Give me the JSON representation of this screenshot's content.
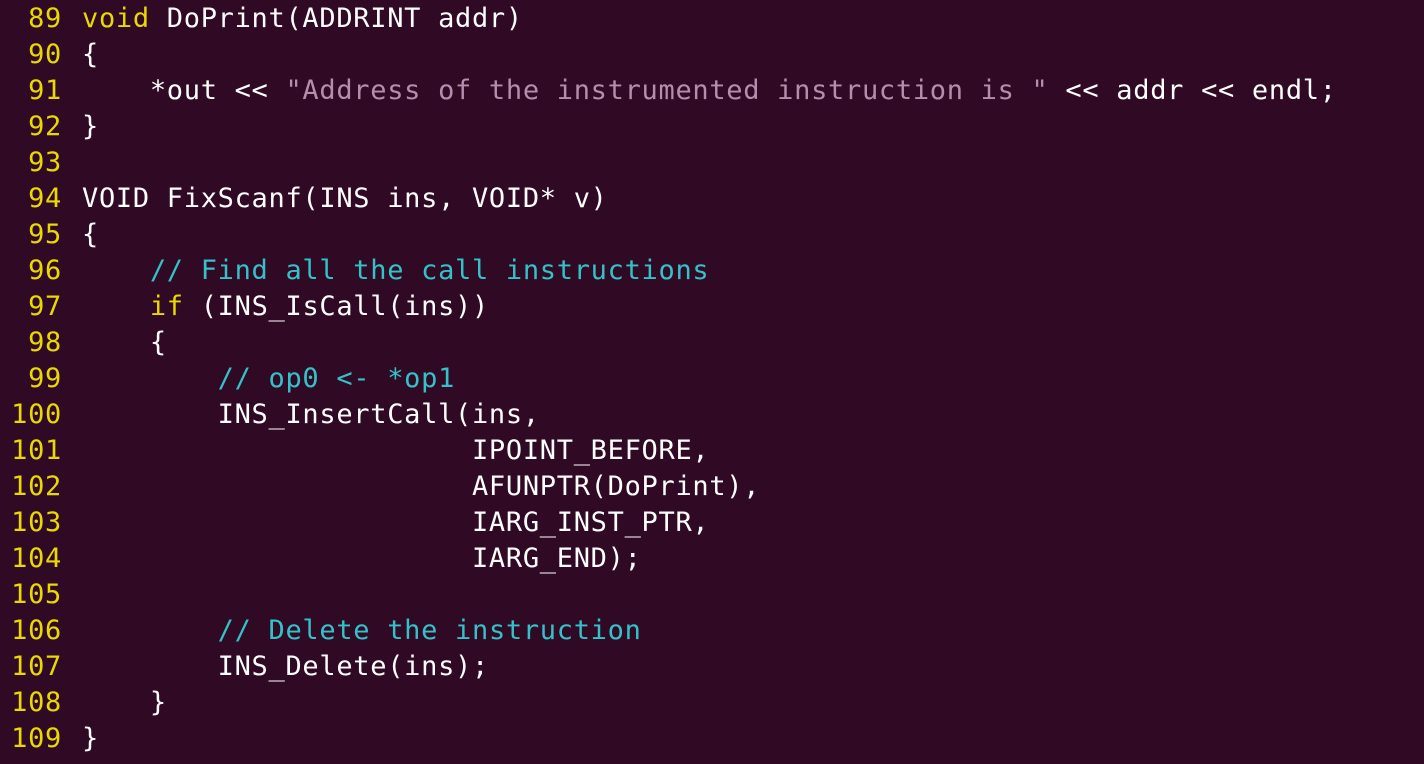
{
  "window_title": "",
  "colors": {
    "background": "#300a24",
    "line_number": "#e8d900",
    "text": "#ffffff",
    "keyword": "#e8d900",
    "string": "#b48ead",
    "comment": "#35c1c9"
  },
  "code": {
    "lines": [
      {
        "number": "89",
        "tokens": [
          {
            "t": "kw",
            "v": "void"
          },
          {
            "t": "text",
            "v": " DoPrint(ADDRINT addr)"
          }
        ]
      },
      {
        "number": "90",
        "tokens": [
          {
            "t": "text",
            "v": "{"
          }
        ]
      },
      {
        "number": "91",
        "tokens": [
          {
            "t": "text",
            "v": "    *out << "
          },
          {
            "t": "str",
            "v": "\"Address of the instrumented instruction is \""
          },
          {
            "t": "text",
            "v": " << addr << endl;"
          }
        ]
      },
      {
        "number": "92",
        "tokens": [
          {
            "t": "text",
            "v": "}"
          }
        ]
      },
      {
        "number": "93",
        "tokens": []
      },
      {
        "number": "94",
        "tokens": [
          {
            "t": "text",
            "v": "VOID FixScanf(INS ins, VOID* v)"
          }
        ]
      },
      {
        "number": "95",
        "tokens": [
          {
            "t": "text",
            "v": "{"
          }
        ]
      },
      {
        "number": "96",
        "tokens": [
          {
            "t": "text",
            "v": "    "
          },
          {
            "t": "comment",
            "v": "// Find all the call instructions"
          }
        ]
      },
      {
        "number": "97",
        "tokens": [
          {
            "t": "text",
            "v": "    "
          },
          {
            "t": "kw",
            "v": "if"
          },
          {
            "t": "text",
            "v": " (INS_IsCall(ins))"
          }
        ]
      },
      {
        "number": "98",
        "tokens": [
          {
            "t": "text",
            "v": "    {"
          }
        ]
      },
      {
        "number": "99",
        "tokens": [
          {
            "t": "text",
            "v": "        "
          },
          {
            "t": "comment",
            "v": "// op0 <- *op1"
          }
        ]
      },
      {
        "number": "100",
        "tokens": [
          {
            "t": "text",
            "v": "        INS_InsertCall(ins,"
          }
        ]
      },
      {
        "number": "101",
        "tokens": [
          {
            "t": "text",
            "v": "                       IPOINT_BEFORE,"
          }
        ]
      },
      {
        "number": "102",
        "tokens": [
          {
            "t": "text",
            "v": "                       AFUNPTR(DoPrint),"
          }
        ]
      },
      {
        "number": "103",
        "tokens": [
          {
            "t": "text",
            "v": "                       IARG_INST_PTR,"
          }
        ]
      },
      {
        "number": "104",
        "tokens": [
          {
            "t": "text",
            "v": "                       IARG_END);"
          }
        ]
      },
      {
        "number": "105",
        "tokens": []
      },
      {
        "number": "106",
        "tokens": [
          {
            "t": "text",
            "v": "        "
          },
          {
            "t": "comment",
            "v": "// Delete the instruction"
          }
        ]
      },
      {
        "number": "107",
        "tokens": [
          {
            "t": "text",
            "v": "        INS_Delete(ins);"
          }
        ]
      },
      {
        "number": "108",
        "tokens": [
          {
            "t": "text",
            "v": "    }"
          }
        ]
      },
      {
        "number": "109",
        "tokens": [
          {
            "t": "text",
            "v": "}"
          }
        ]
      }
    ]
  }
}
